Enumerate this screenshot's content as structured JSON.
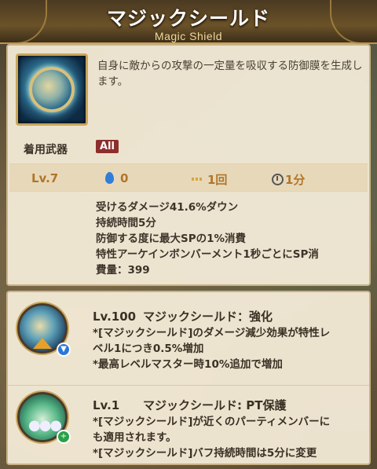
{
  "header": {
    "title_ja": "マジックシールド",
    "title_en": "Magic Shield"
  },
  "skill": {
    "icon": "magic-shield-icon",
    "description": "自身に敵からの攻撃の一定量を吸収する防御膜を生成します。",
    "weapon_label": "着用武器",
    "weapon_value": "All",
    "stats": {
      "level": "Lv.7",
      "sp_cost": "0",
      "uses": "1回",
      "cooldown": "1分"
    },
    "effects": [
      "受けるダメージ41.6%ダウン",
      "持続時間5分",
      "防御する度に最大SPの1%消費",
      "特性アーケインボンバーメント1秒ごとにSP消",
      "費量：399"
    ]
  },
  "enhancements": [
    {
      "level": "Lv.100",
      "name": "マジックシールド：強化",
      "icon": "shield-upgrade-icon",
      "lines": [
        "*[マジックシールド]のダメージ減少効果が特性レ",
        "ベル1につき0.5%増加",
        "*最高レベルマスター時10%追加で増加"
      ]
    },
    {
      "level": "Lv.1",
      "name": "マジックシールド: PT保護",
      "icon": "party-protect-icon",
      "lines": [
        "*[マジックシールド]が近くのパーティメンバーに",
        "も適用されます。",
        "*[マジックシールド]バフ持続時間は5分に変更"
      ]
    }
  ],
  "colors": {
    "panel_bg": "#f6eeda",
    "accent_gold": "#b0762a",
    "weapon_badge": "#8c2f2c"
  }
}
